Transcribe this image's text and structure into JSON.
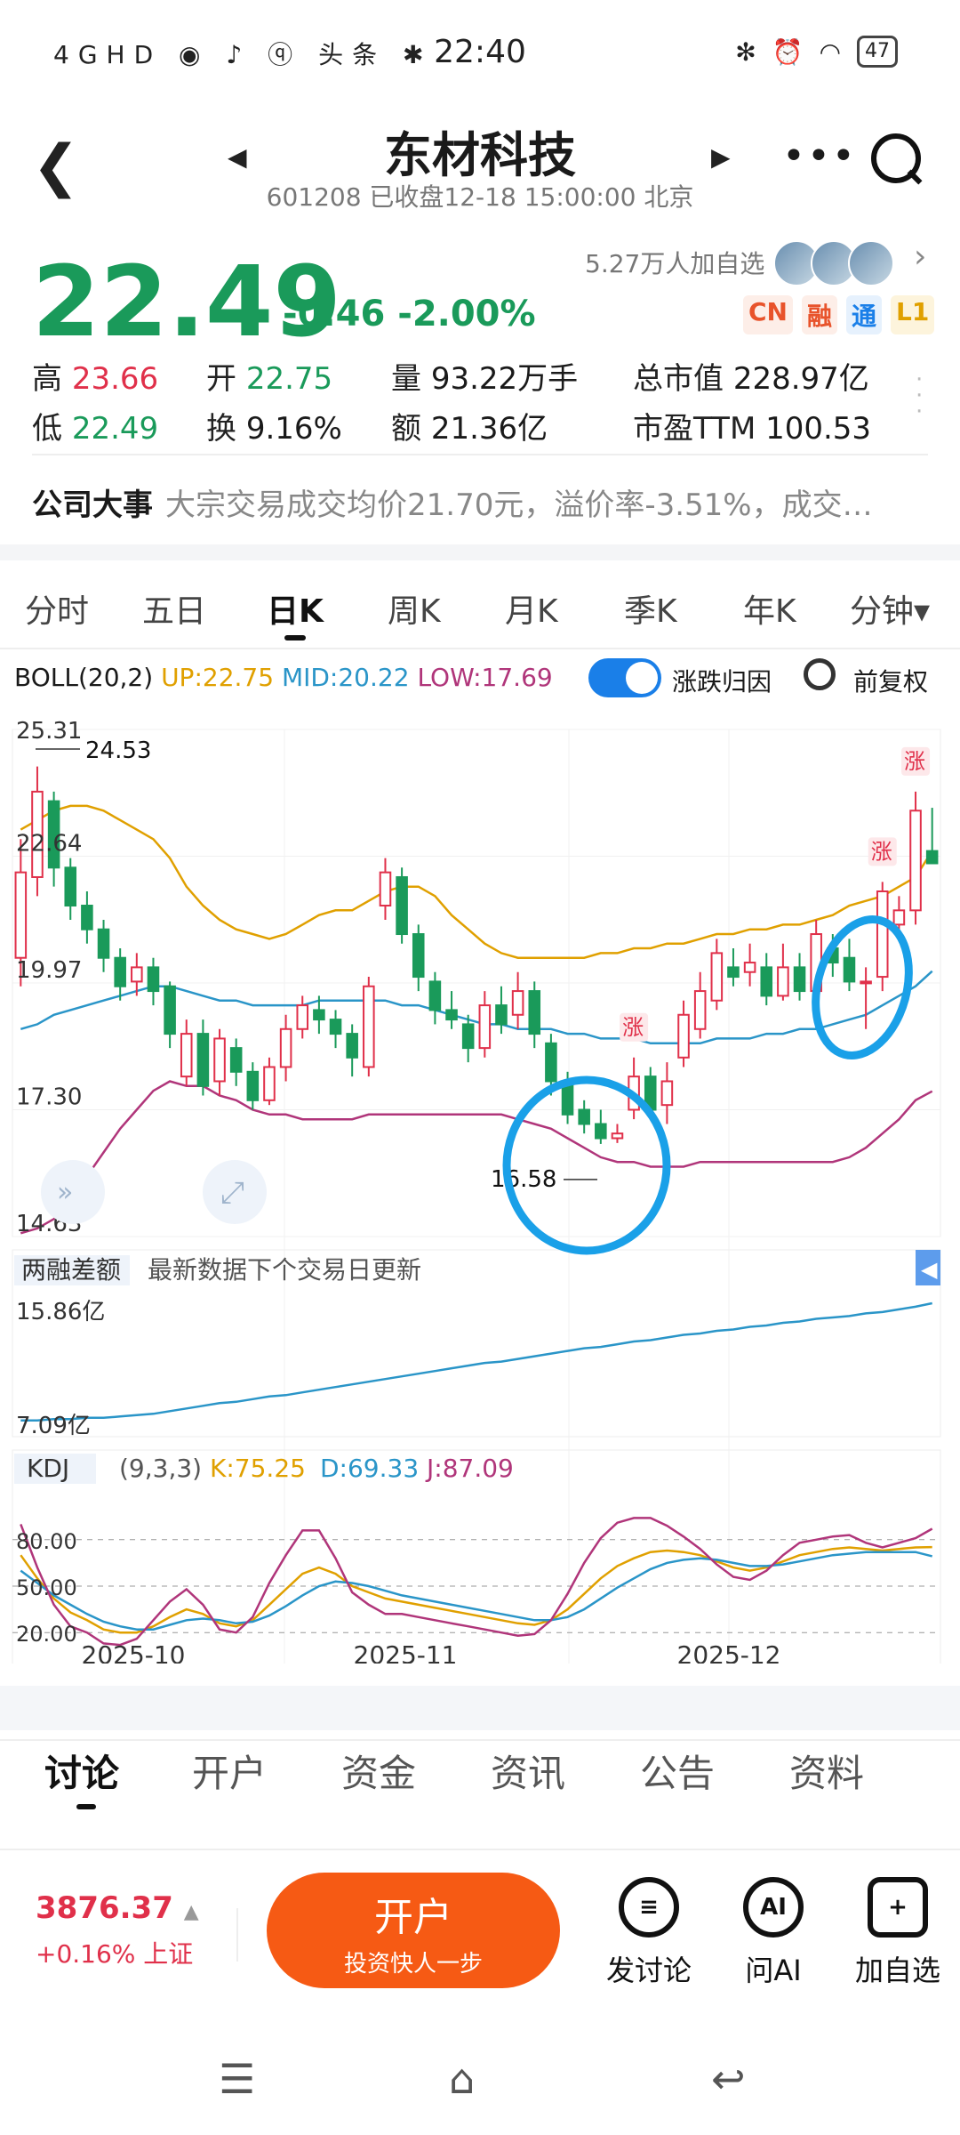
{
  "status_bar": {
    "time": "22:40",
    "left_icons": [
      "4GHD",
      "wechat-icon",
      "tiktok-icon",
      "q-icon",
      "头条",
      "app-icon"
    ],
    "battery": "47"
  },
  "header": {
    "title": "东材科技",
    "subtitle": "601208 已收盘12-18 15:00:00 北京"
  },
  "quote": {
    "price": "22.49",
    "change": "-0.46 -2.00%",
    "followers": "5.27万人加自选",
    "badges": [
      {
        "text": "CN",
        "color": "#e8532b",
        "bg": "#fdeee8"
      },
      {
        "text": "融",
        "color": "#e8532b",
        "bg": "#fdeee8"
      },
      {
        "text": "通",
        "color": "#1a7fe8",
        "bg": "#e6f1fd"
      },
      {
        "text": "L1",
        "color": "#e0a000",
        "bg": "#fdf4dc"
      }
    ],
    "stats": {
      "high_label": "高",
      "high": "23.66",
      "open_label": "开",
      "open": "22.75",
      "volume_label": "量",
      "volume": "93.22万手",
      "mktcap_label": "总市值",
      "mktcap": "228.97亿",
      "low_label": "低",
      "low": "22.49",
      "turnover_label": "换",
      "turnover": "9.16%",
      "amount_label": "额",
      "amount": "21.36亿",
      "pe_label": "市盈TTM",
      "pe": "100.53"
    }
  },
  "event": {
    "label": "公司大事",
    "text": "大宗交易成交均价21.70元，溢价率-3.51%，成交…"
  },
  "chart_tabs": [
    "分时",
    "五日",
    "日K",
    "周K",
    "月K",
    "季K",
    "年K",
    "分钟▾"
  ],
  "active_chart_tab": "日K",
  "indicator": {
    "name": "BOLL(20,2)",
    "up": "UP:22.75",
    "mid": "MID:20.22",
    "low": "LOW:17.69",
    "toggle_label": "涨跌归因",
    "adjust_label": "前复权"
  },
  "margin_panel": {
    "title": "两融差额",
    "note": "最新数据下个交易日更新",
    "top_label": "15.86亿",
    "bottom_label": "7.09亿"
  },
  "kdj_panel": {
    "name": "KDJ",
    "params": "(9,3,3)",
    "k": "K:75.25",
    "d": "D:69.33",
    "j": "J:87.09"
  },
  "chart_data": {
    "type": "candlestick",
    "y_axis_labels": [
      "25.31",
      "22.64",
      "19.97",
      "17.30",
      "14.63"
    ],
    "ylim": [
      14.63,
      25.31
    ],
    "x_labels": [
      "2025-10",
      "2025-11",
      "2025-12"
    ],
    "annotations": {
      "max": "24.53",
      "min": "16.58",
      "marker": "涨"
    },
    "candles": [
      {
        "o": 20.5,
        "c": 22.3,
        "h": 23.0,
        "l": 19.9
      },
      {
        "o": 22.2,
        "c": 24.0,
        "h": 24.53,
        "l": 21.8
      },
      {
        "o": 23.8,
        "c": 22.4,
        "h": 24.0,
        "l": 22.0
      },
      {
        "o": 22.4,
        "c": 21.6,
        "h": 22.6,
        "l": 21.3
      },
      {
        "o": 21.6,
        "c": 21.1,
        "h": 21.9,
        "l": 20.8
      },
      {
        "o": 21.1,
        "c": 20.5,
        "h": 21.3,
        "l": 20.2
      },
      {
        "o": 20.5,
        "c": 19.9,
        "h": 20.7,
        "l": 19.6
      },
      {
        "o": 20.0,
        "c": 20.3,
        "h": 20.6,
        "l": 19.7
      },
      {
        "o": 20.3,
        "c": 19.8,
        "h": 20.5,
        "l": 19.5
      },
      {
        "o": 19.9,
        "c": 18.9,
        "h": 20.0,
        "l": 18.6
      },
      {
        "o": 18.0,
        "c": 18.9,
        "h": 19.2,
        "l": 17.8
      },
      {
        "o": 18.9,
        "c": 17.8,
        "h": 19.2,
        "l": 17.6
      },
      {
        "o": 17.9,
        "c": 18.8,
        "h": 19.0,
        "l": 17.6
      },
      {
        "o": 18.6,
        "c": 18.1,
        "h": 18.8,
        "l": 17.8
      },
      {
        "o": 18.1,
        "c": 17.5,
        "h": 18.3,
        "l": 17.3
      },
      {
        "o": 17.5,
        "c": 18.2,
        "h": 18.4,
        "l": 17.4
      },
      {
        "o": 18.2,
        "c": 19.0,
        "h": 19.3,
        "l": 17.9
      },
      {
        "o": 19.0,
        "c": 19.5,
        "h": 19.7,
        "l": 18.8
      },
      {
        "o": 19.4,
        "c": 19.2,
        "h": 19.7,
        "l": 18.9
      },
      {
        "o": 19.2,
        "c": 18.9,
        "h": 19.4,
        "l": 18.6
      },
      {
        "o": 18.9,
        "c": 18.4,
        "h": 19.1,
        "l": 18.0
      },
      {
        "o": 18.2,
        "c": 19.9,
        "h": 20.1,
        "l": 18.0
      },
      {
        "o": 21.6,
        "c": 22.3,
        "h": 22.6,
        "l": 21.3
      },
      {
        "o": 22.2,
        "c": 21.0,
        "h": 22.4,
        "l": 20.8
      },
      {
        "o": 21.0,
        "c": 20.1,
        "h": 21.2,
        "l": 19.8
      },
      {
        "o": 20.0,
        "c": 19.4,
        "h": 20.2,
        "l": 19.1
      },
      {
        "o": 19.4,
        "c": 19.2,
        "h": 19.8,
        "l": 19.0
      },
      {
        "o": 19.1,
        "c": 18.6,
        "h": 19.3,
        "l": 18.3
      },
      {
        "o": 18.6,
        "c": 19.5,
        "h": 19.8,
        "l": 18.4
      },
      {
        "o": 19.5,
        "c": 19.1,
        "h": 19.9,
        "l": 18.9
      },
      {
        "o": 19.3,
        "c": 19.8,
        "h": 20.2,
        "l": 19.0
      },
      {
        "o": 19.8,
        "c": 18.9,
        "h": 20.0,
        "l": 18.6
      },
      {
        "o": 18.7,
        "c": 17.9,
        "h": 18.9,
        "l": 17.6
      },
      {
        "o": 17.9,
        "c": 17.2,
        "h": 18.1,
        "l": 17.0
      },
      {
        "o": 17.3,
        "c": 17.0,
        "h": 17.5,
        "l": 16.8
      },
      {
        "o": 17.0,
        "c": 16.7,
        "h": 17.3,
        "l": 16.58
      },
      {
        "o": 16.7,
        "c": 16.8,
        "h": 17.0,
        "l": 16.6
      },
      {
        "o": 17.3,
        "c": 18.0,
        "h": 18.4,
        "l": 17.1
      },
      {
        "o": 18.0,
        "c": 17.3,
        "h": 18.2,
        "l": 17.1
      },
      {
        "o": 17.4,
        "c": 17.9,
        "h": 18.3,
        "l": 17.0
      },
      {
        "o": 18.4,
        "c": 19.3,
        "h": 19.6,
        "l": 18.2
      },
      {
        "o": 19.0,
        "c": 19.8,
        "h": 20.2,
        "l": 18.8
      },
      {
        "o": 19.6,
        "c": 20.6,
        "h": 20.9,
        "l": 19.4
      },
      {
        "o": 20.3,
        "c": 20.1,
        "h": 20.7,
        "l": 19.9
      },
      {
        "o": 20.2,
        "c": 20.4,
        "h": 20.8,
        "l": 19.9
      },
      {
        "o": 20.3,
        "c": 19.7,
        "h": 20.6,
        "l": 19.5
      },
      {
        "o": 19.7,
        "c": 20.3,
        "h": 20.8,
        "l": 19.6
      },
      {
        "o": 20.3,
        "c": 19.8,
        "h": 20.6,
        "l": 19.6
      },
      {
        "o": 19.8,
        "c": 21.0,
        "h": 21.3,
        "l": 19.7
      },
      {
        "o": 20.7,
        "c": 20.4,
        "h": 21.0,
        "l": 20.1
      },
      {
        "o": 20.5,
        "c": 20.0,
        "h": 20.9,
        "l": 19.8
      },
      {
        "o": 20.0,
        "c": 20.0,
        "h": 20.3,
        "l": 19.0
      },
      {
        "o": 20.1,
        "c": 21.9,
        "h": 22.1,
        "l": 19.8
      },
      {
        "o": 21.2,
        "c": 21.5,
        "h": 21.8,
        "l": 21.0
      },
      {
        "o": 21.5,
        "c": 23.6,
        "h": 24.0,
        "l": 21.2
      },
      {
        "o": 22.75,
        "c": 22.49,
        "h": 23.66,
        "l": 22.49
      }
    ],
    "boll_up": [
      23.2,
      23.4,
      23.6,
      23.7,
      23.7,
      23.6,
      23.4,
      23.2,
      23.0,
      22.6,
      22.0,
      21.6,
      21.3,
      21.1,
      21.0,
      20.9,
      21.0,
      21.2,
      21.4,
      21.5,
      21.5,
      21.7,
      21.9,
      22.0,
      22.0,
      21.8,
      21.4,
      21.1,
      20.8,
      20.6,
      20.5,
      20.5,
      20.5,
      20.5,
      20.5,
      20.6,
      20.6,
      20.7,
      20.7,
      20.8,
      20.8,
      20.9,
      21.0,
      21.0,
      21.1,
      21.1,
      21.2,
      21.2,
      21.3,
      21.4,
      21.6,
      21.7,
      21.8,
      22.0,
      22.2,
      22.75
    ],
    "boll_mid": [
      19.0,
      19.1,
      19.3,
      19.4,
      19.5,
      19.6,
      19.7,
      19.8,
      19.9,
      19.9,
      19.8,
      19.7,
      19.6,
      19.6,
      19.5,
      19.5,
      19.5,
      19.5,
      19.6,
      19.6,
      19.6,
      19.6,
      19.6,
      19.5,
      19.5,
      19.4,
      19.3,
      19.2,
      19.1,
      19.1,
      19.0,
      19.0,
      19.0,
      18.9,
      18.9,
      18.8,
      18.8,
      18.8,
      18.7,
      18.7,
      18.7,
      18.7,
      18.8,
      18.8,
      18.8,
      18.9,
      18.9,
      19.0,
      19.0,
      19.1,
      19.2,
      19.3,
      19.5,
      19.7,
      19.9,
      20.22
    ],
    "boll_low": [
      14.7,
      14.8,
      15.0,
      15.4,
      15.9,
      16.4,
      16.9,
      17.3,
      17.7,
      17.9,
      17.8,
      17.8,
      17.6,
      17.5,
      17.3,
      17.2,
      17.2,
      17.1,
      17.1,
      17.1,
      17.1,
      17.2,
      17.2,
      17.2,
      17.2,
      17.2,
      17.2,
      17.2,
      17.2,
      17.2,
      17.1,
      17.0,
      16.9,
      16.7,
      16.5,
      16.3,
      16.2,
      16.2,
      16.1,
      16.1,
      16.1,
      16.2,
      16.2,
      16.2,
      16.2,
      16.2,
      16.2,
      16.2,
      16.2,
      16.2,
      16.3,
      16.5,
      16.8,
      17.1,
      17.5,
      17.69
    ],
    "margin_values": [
      7.1,
      7.1,
      7.2,
      7.2,
      7.3,
      7.3,
      7.4,
      7.5,
      7.6,
      7.8,
      8.0,
      8.2,
      8.4,
      8.5,
      8.7,
      8.9,
      9.0,
      9.2,
      9.4,
      9.6,
      9.8,
      10.0,
      10.2,
      10.4,
      10.6,
      10.8,
      11.0,
      11.2,
      11.4,
      11.5,
      11.7,
      11.9,
      12.1,
      12.3,
      12.5,
      12.6,
      12.8,
      13.0,
      13.1,
      13.3,
      13.5,
      13.6,
      13.8,
      13.9,
      14.1,
      14.2,
      14.4,
      14.5,
      14.7,
      14.8,
      14.9,
      15.1,
      15.2,
      15.4,
      15.6,
      15.86
    ],
    "kdj": {
      "levels": [
        "80.00",
        "50.00",
        "20.00"
      ],
      "k": [
        70,
        55,
        42,
        33,
        28,
        22,
        20,
        20,
        24,
        30,
        35,
        32,
        26,
        24,
        28,
        38,
        48,
        58,
        62,
        58,
        50,
        46,
        42,
        40,
        38,
        36,
        34,
        32,
        30,
        28,
        26,
        25,
        28,
        35,
        45,
        55,
        63,
        68,
        72,
        73,
        72,
        70,
        66,
        62,
        60,
        62,
        66,
        70,
        72,
        74,
        75,
        74,
        73,
        74,
        75,
        75.25
      ],
      "d": [
        60,
        52,
        44,
        38,
        32,
        27,
        24,
        22,
        22,
        25,
        28,
        29,
        28,
        26,
        27,
        31,
        37,
        44,
        50,
        53,
        52,
        50,
        47,
        44,
        42,
        40,
        38,
        36,
        34,
        32,
        30,
        28,
        28,
        30,
        35,
        42,
        49,
        55,
        61,
        65,
        67,
        68,
        67,
        65,
        63,
        63,
        64,
        66,
        68,
        70,
        71,
        72,
        72,
        72,
        72,
        69.33
      ],
      "j": [
        90,
        62,
        38,
        24,
        20,
        13,
        12,
        16,
        28,
        40,
        48,
        38,
        22,
        20,
        30,
        52,
        70,
        86,
        86,
        68,
        46,
        38,
        32,
        32,
        30,
        28,
        26,
        24,
        22,
        20,
        18,
        19,
        28,
        45,
        65,
        81,
        91,
        94,
        94,
        89,
        82,
        74,
        64,
        56,
        54,
        60,
        70,
        78,
        80,
        82,
        83,
        78,
        75,
        78,
        81,
        87.09
      ]
    }
  },
  "bottom_tabs": [
    "讨论",
    "开户",
    "资金",
    "资讯",
    "公告",
    "资料"
  ],
  "active_bottom_tab": "讨论",
  "market_index": {
    "value": "3876.37",
    "change": "+0.16% 上证"
  },
  "cta": {
    "title": "开户",
    "subtitle": "投资快人一步"
  },
  "actions": [
    {
      "label": "发讨论",
      "icon": "comment-icon"
    },
    {
      "label": "问AI",
      "icon": "ai-icon"
    },
    {
      "label": "加自选",
      "icon": "add-icon"
    }
  ],
  "colors": {
    "up": "#e0304a",
    "down": "#1a9a5a",
    "boll_up": "#e0a000",
    "boll_mid": "#2a95c8",
    "boll_low": "#b0357a",
    "highlight": "#1aa0e8"
  }
}
